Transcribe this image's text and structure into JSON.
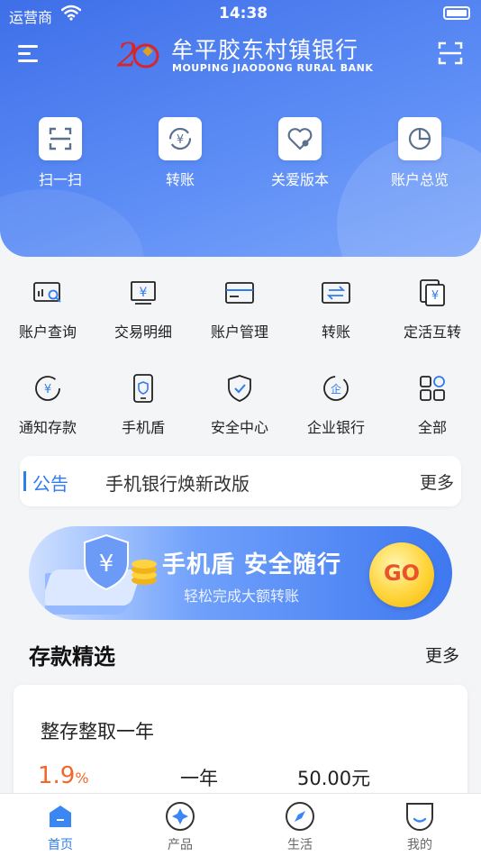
{
  "status_bar": {
    "carrier": "运营商",
    "time": "14:38"
  },
  "header": {
    "bank_name": "牟平胶东村镇银行",
    "bank_name_en": "MOUPING JIAODONG  RURAL BANK"
  },
  "top_quick": [
    {
      "label": "扫一扫",
      "icon": "scan-icon"
    },
    {
      "label": "转账",
      "icon": "transfer-icon"
    },
    {
      "label": "关爱版本",
      "icon": "heart-icon"
    },
    {
      "label": "账户总览",
      "icon": "pie-chart-icon"
    }
  ],
  "grid": [
    {
      "label": "账户查询",
      "icon": "account-query-icon"
    },
    {
      "label": "交易明细",
      "icon": "transaction-detail-icon"
    },
    {
      "label": "账户管理",
      "icon": "card-icon"
    },
    {
      "label": "转账",
      "icon": "transfer-icon"
    },
    {
      "label": "定活互转",
      "icon": "fixed-current-icon"
    },
    {
      "label": "通知存款",
      "icon": "notice-deposit-icon"
    },
    {
      "label": "手机盾",
      "icon": "phone-shield-icon"
    },
    {
      "label": "安全中心",
      "icon": "shield-check-icon"
    },
    {
      "label": "企业银行",
      "icon": "enterprise-icon"
    },
    {
      "label": "全部",
      "icon": "all-grid-icon"
    }
  ],
  "notice": {
    "tag": "公告",
    "text": "手机银行焕新改版",
    "more": "更多"
  },
  "banner": {
    "title": "手机盾 安全随行",
    "subtitle": "轻松完成大额转账",
    "go": "GO"
  },
  "deposit_section": {
    "title": "存款精选",
    "more": "更多"
  },
  "deposit_card": {
    "name": "整存整取一年",
    "rate": "1.9",
    "rate_unit": "%",
    "term": "一年",
    "amount": "50.00元"
  },
  "tabbar": [
    {
      "label": "首页",
      "icon": "home-icon",
      "active": true
    },
    {
      "label": "产品",
      "icon": "product-icon",
      "active": false
    },
    {
      "label": "生活",
      "icon": "compass-icon",
      "active": false
    },
    {
      "label": "我的",
      "icon": "profile-icon",
      "active": false
    }
  ],
  "colors": {
    "primary": "#2f7bf0",
    "rate": "#f2672a",
    "hero": "#4f80ee"
  }
}
